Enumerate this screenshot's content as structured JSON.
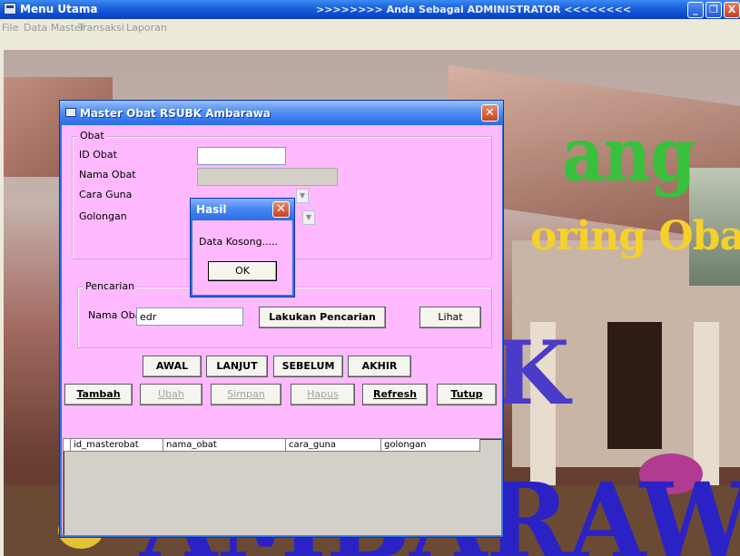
{
  "main_window": {
    "title": "Menu Utama",
    "role_banner": ">>>>>>>> Anda Sebagai ADMINISTRATOR <<<<<<<<",
    "caption_buttons": {
      "minimize": "_",
      "restore": "❐",
      "close": "X"
    }
  },
  "menubar": {
    "items": [
      "File",
      "Data Master",
      "Transaksi",
      "Laporan"
    ]
  },
  "background": {
    "line1": "ang",
    "line2": "oring Obat",
    "line3": "K",
    "line4": "AMBARAWA"
  },
  "dialog": {
    "title": "Master Obat RSUBK Ambarawa",
    "close_glyph": "✕",
    "obat_group": {
      "label": "Obat",
      "id_label": "ID Obat",
      "id_value": "",
      "nama_label": "Nama Obat",
      "nama_value": "",
      "cara_label": "Cara Guna",
      "golongan_label": "Golongan"
    },
    "search_group": {
      "label": "Pencarian",
      "nama_label": "Nama Obat",
      "nama_value": "edr",
      "search_button": "Lakukan Pencarian",
      "lihat_button": "Lihat"
    },
    "nav_buttons": {
      "awal": "AWAL",
      "lanjut": "LANJUT",
      "sebelum": "SEBELUM",
      "akhir": "AKHIR"
    },
    "action_buttons": {
      "tambah": "Tambah",
      "ubah": "Ubah",
      "simpan": "Simpan",
      "hapus": "Hapus",
      "refresh": "Refresh",
      "tutup": "Tutup"
    },
    "grid": {
      "columns": [
        "id_masterobat",
        "nama_obat",
        "cara_guna",
        "golongan"
      ],
      "rows": []
    }
  },
  "message_box": {
    "title": "Hasil",
    "close_glyph": "✕",
    "message": "Data Kosong.....",
    "ok_button": "OK"
  },
  "colors": {
    "dialog_background": "#ffbaff",
    "titlebar_blue": "#2c6de6",
    "close_red": "#c74321"
  }
}
